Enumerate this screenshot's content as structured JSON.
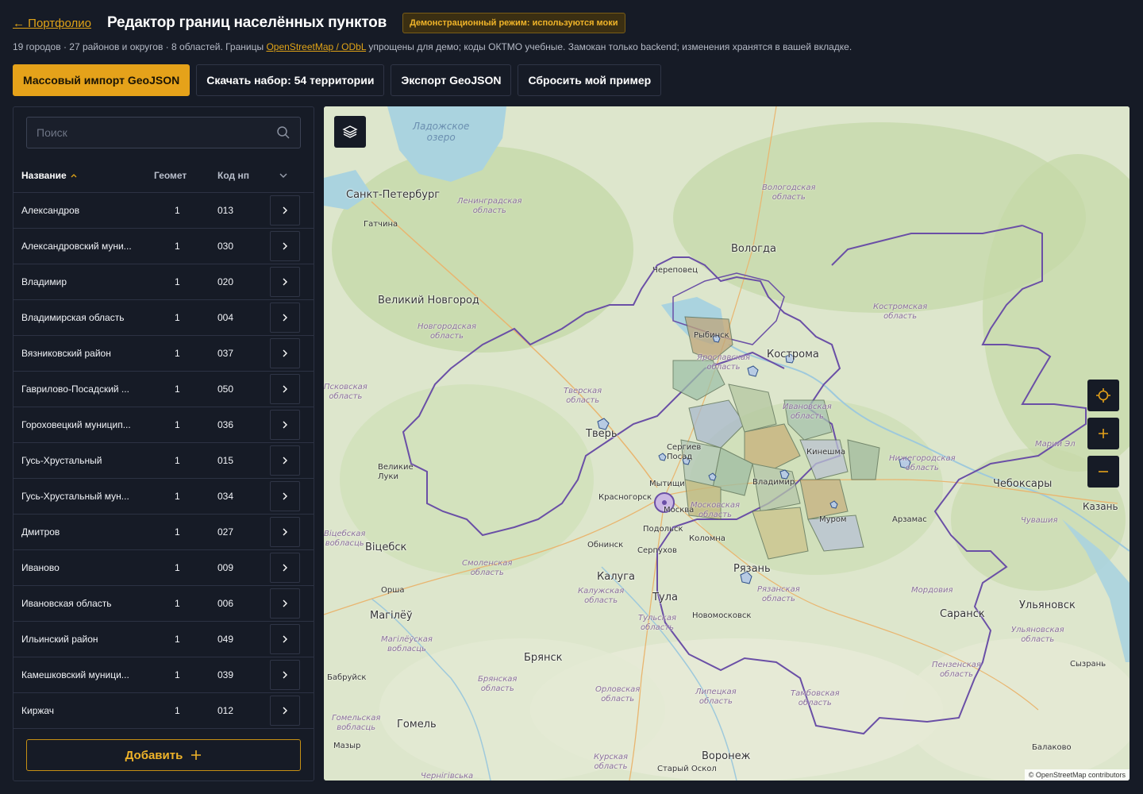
{
  "header": {
    "back_link": "← Портфолио",
    "title": "Редактор границ населённых пунктов",
    "demo_badge": "Демонстрационный режим: используются моки"
  },
  "subline": {
    "before": "19 городов · 27 районов и округов · 8 областей. Границы ",
    "link": "OpenStreetMap / ODbL",
    "after": " упрощены для демо; коды ОКТМО учебные. Замокан только backend; изменения хранятся в вашей вкладке."
  },
  "toolbar": {
    "import_label": "Массовый импорт GeoJSON",
    "download_label": "Скачать набор: 54 территории",
    "export_label": "Экспорт GeoJSON",
    "reset_label": "Сбросить мой пример"
  },
  "search": {
    "placeholder": "Поиск",
    "value": ""
  },
  "table": {
    "col_name": "Название",
    "col_geom": "Геомет",
    "col_code": "Код нп",
    "rows": [
      {
        "name": "Александров",
        "geom": "1",
        "code": "013"
      },
      {
        "name": "Александровский муни...",
        "geom": "1",
        "code": "030"
      },
      {
        "name": "Владимир",
        "geom": "1",
        "code": "020"
      },
      {
        "name": "Владимирская область",
        "geom": "1",
        "code": "004"
      },
      {
        "name": "Вязниковский район",
        "geom": "1",
        "code": "037"
      },
      {
        "name": "Гаврилово-Посадский ...",
        "geom": "1",
        "code": "050"
      },
      {
        "name": "Гороховецкий муницип...",
        "geom": "1",
        "code": "036"
      },
      {
        "name": "Гусь-Хрустальный",
        "geom": "1",
        "code": "015"
      },
      {
        "name": "Гусь-Хрустальный мун...",
        "geom": "1",
        "code": "034"
      },
      {
        "name": "Дмитров",
        "geom": "1",
        "code": "027"
      },
      {
        "name": "Иваново",
        "geom": "1",
        "code": "009"
      },
      {
        "name": "Ивановская область",
        "geom": "1",
        "code": "006"
      },
      {
        "name": "Ильинский район",
        "geom": "1",
        "code": "049"
      },
      {
        "name": "Камешковский муници...",
        "geom": "1",
        "code": "039"
      },
      {
        "name": "Киржач",
        "geom": "1",
        "code": "012"
      }
    ]
  },
  "add_button": "Добавить",
  "map": {
    "attribution": "© OpenStreetMap contributors",
    "cities": {
      "spb": "Санкт-Петербург",
      "gatchina": "Гатчина",
      "vologda": "Вологда",
      "cherepovets": "Череповец",
      "vnovgorod": "Великий Новгород",
      "rybinsk": "Рыбинск",
      "kostroma": "Кострома",
      "tver": "Тверь",
      "sergiev": "Сергиев Посад",
      "vluki": "Великие Луки",
      "mytishchi": "Мытищи",
      "krasnogorsk": "Красногорск",
      "moskva": "Москва",
      "podolsk": "Подольск",
      "obninsk": "Обнинск",
      "serpukhov": "Серпухов",
      "kolomna": "Коломна",
      "vitebsk": "Віцебск",
      "kaluga": "Калуга",
      "tula": "Тула",
      "ryazan": "Рязань",
      "orsha": "Орша",
      "mogilev": "Магілёў",
      "novomoskovsk": "Новомосковск",
      "bryansk": "Брянск",
      "bobruisk": "Бабруйск",
      "gomel": "Гомель",
      "mozyr": "Мазыр",
      "voronezh": "Воронеж",
      "stary": "Старый Оскол",
      "cheboksary": "Чебоксары",
      "kazan": "Казань",
      "arzamas": "Арзамас",
      "saransk": "Саранск",
      "ulyanovsk": "Ульяновск",
      "syzran": "Сызрань",
      "balakovo": "Балаково",
      "murom": "Муром",
      "vladimir": "Владимир",
      "ivanovo": "Кинешма"
    },
    "regions": {
      "ladoga": "Ладожское\nозеро",
      "leningrad": "Ленинградская\nобласть",
      "vologodskaya": "Вологодская\nобласть",
      "novgorodskaya": "Новгородская\nобласть",
      "yaroslavskaya": "Ярославская\nобласть",
      "kostromskaya": "Костромская\nобласть",
      "pskovskaya": "Псковская\nобласть",
      "tverskaya": "Тверская\nобласть",
      "ivanovskaya": "Ивановская\nобласть",
      "nizhegorodskaya": "Нижегородская\nобласть",
      "mariy": "Марий Эл",
      "moskovskaya": "Московская\nобласть",
      "smolenskaya": "Смоленская\nобласть",
      "vitebskaya": "Віцебская\nвобласць",
      "kaluzhskaya": "Калужская\nобласть",
      "ryazanskaya": "Рязанская\nобласть",
      "tulskaya": "Тульская\nобласть",
      "mogilevskaya": "Магілёўская\nвобласць",
      "bryanskaya": "Брянская\nобласть",
      "orlovskaya": "Орловская\nобласть",
      "lipetskaya": "Липецкая\nобласть",
      "tambovskaya": "Тамбовская\nобласть",
      "penzenskaya": "Пензенская\nобласть",
      "ulyanovskaya": "Ульяновская\nобласть",
      "mordoviya": "Мордовия",
      "chuvashiya": "Чувашия",
      "gomelskaya": "Гомельская\nвобласць",
      "kurskaya": "Курская\nобласть",
      "chernigivska": "Чернігівська",
      "vladimirskaya": "Владимирская\nобласть"
    }
  },
  "colors": {
    "accent": "#e5a21a",
    "background": "#161b26",
    "panel_border": "#2c3243",
    "boundary": "#6a4fa6"
  },
  "icons": {
    "search": "search-icon",
    "sort": "sort-asc-icon",
    "columns": "chevron-down-icon",
    "row_open": "chevron-right-icon",
    "add": "plus-icon",
    "layers": "layers-icon",
    "locate": "crosshair-icon",
    "zoom_in": "plus-icon",
    "zoom_out": "minus-icon"
  }
}
